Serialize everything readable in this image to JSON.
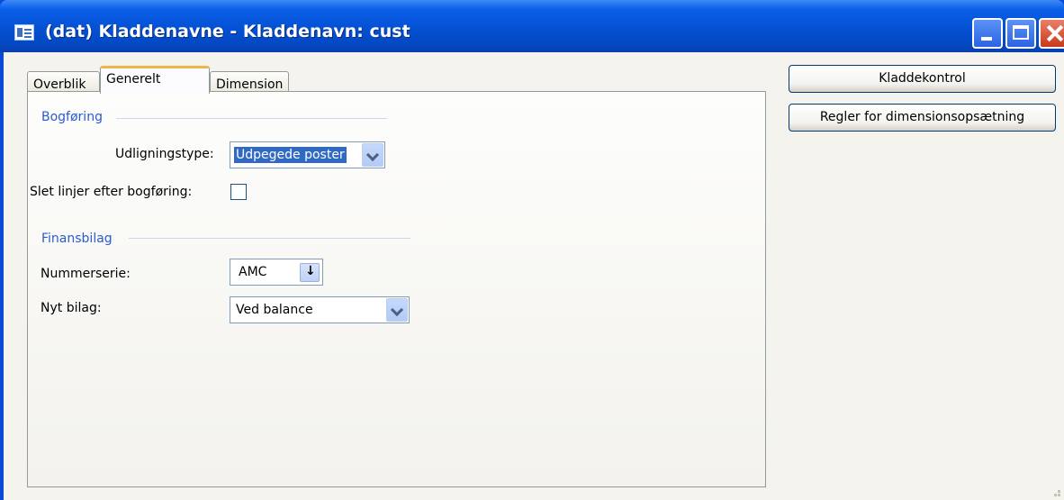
{
  "window": {
    "title": "(dat) Kladdenavne - Kladdenavn: cust"
  },
  "tabs": [
    {
      "label": "Overblik"
    },
    {
      "label": "Generelt"
    },
    {
      "label": "Dimension"
    }
  ],
  "active_tab": "Generelt",
  "bogforing": {
    "group_label": "Bogføring",
    "udligningstype_label": "Udligningstype:",
    "udligningstype_value": "Udpegede poster",
    "slet_linjer_label": "Slet linjer efter bogføring:",
    "slet_linjer_checked": false
  },
  "finansbilag": {
    "group_label": "Finansbilag",
    "nummerserie_label": "Nummerserie:",
    "nummerserie_value": "AMC",
    "nyt_bilag_label": "Nyt bilag:",
    "nyt_bilag_value": "Ved balance"
  },
  "side_buttons": {
    "kladdekontrol": "Kladdekontrol",
    "regler": "Regler for dimensionsopsætning"
  },
  "colors": {
    "titlebar": "#0552d6",
    "group_label": "#2a5bd0",
    "selection": "#316ac5",
    "active_tab_accent": "#f0b54a"
  }
}
